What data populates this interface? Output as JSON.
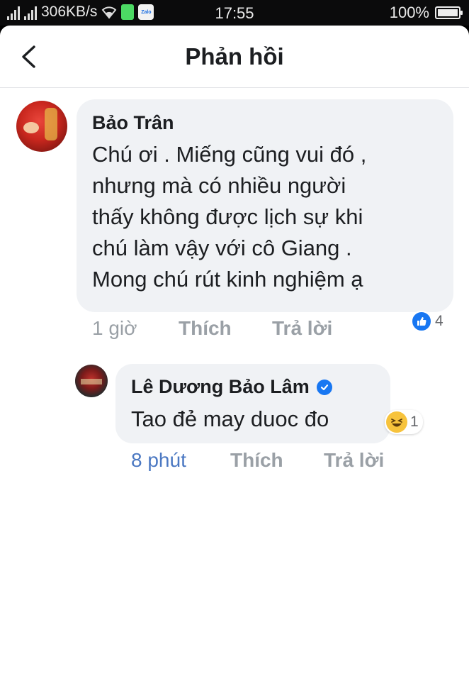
{
  "status_bar": {
    "net_speed": "306KB/s",
    "zalo_label": "Zalo",
    "time": "17:55",
    "battery": "100%",
    "battery_level": 1.0
  },
  "header": {
    "title": "Phản hồi"
  },
  "comments": [
    {
      "author": "Bảo Trân",
      "text": "Chú ơi . Miếng cũng vui đó ,\nnhưng mà có nhiều người\nthấy không được lịch sự khi\nchú làm vậy với cô  Giang .\nMong chú rút kinh nghiệm ạ",
      "reaction_icon": "like-icon",
      "reaction_count": "4",
      "time": "1 giờ",
      "like_label": "Thích",
      "reply_label": "Trả lời"
    },
    {
      "author": "Lê Dương Bảo Lâm",
      "verified": true,
      "text": "Tao đẻ may duoc đo",
      "reaction_icon": "haha-icon",
      "reaction_count": "1",
      "time": "8 phút",
      "like_label": "Thích",
      "reply_label": "Trả lời"
    }
  ],
  "colors": {
    "facebook_blue": "#1877f2",
    "bubble": "#f0f2f5",
    "meta_gray": "#9aa0a6",
    "time_link": "#4b78c2"
  }
}
